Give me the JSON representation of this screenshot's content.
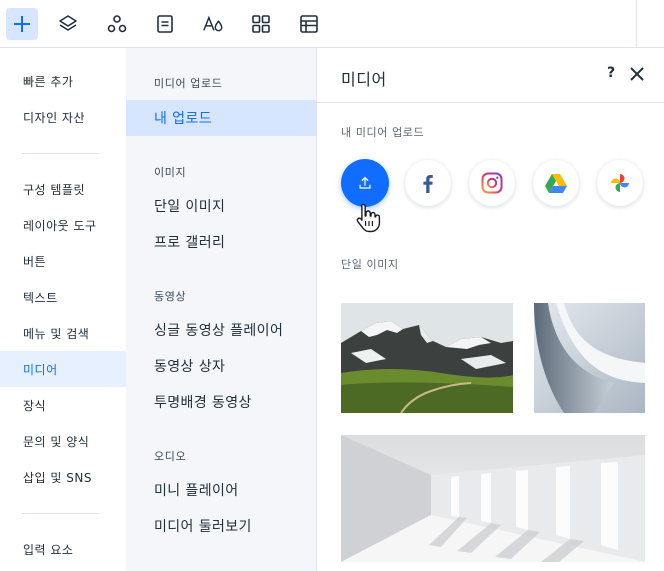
{
  "toolbar": {
    "tools": [
      {
        "icon": "plus-icon",
        "active": true
      },
      {
        "icon": "layers-icon"
      },
      {
        "icon": "apps-icon"
      },
      {
        "icon": "page-icon"
      },
      {
        "icon": "text-theme-icon"
      },
      {
        "icon": "grid-icon"
      },
      {
        "icon": "table-icon"
      }
    ]
  },
  "leftnav": {
    "items": [
      {
        "label": "빠른 추가"
      },
      {
        "label": "디자인 자산"
      },
      {
        "label": "구성 템플릿"
      },
      {
        "label": "레이아웃 도구"
      },
      {
        "label": "버튼"
      },
      {
        "label": "텍스트"
      },
      {
        "label": "메뉴 및 검색"
      },
      {
        "label": "미디어",
        "active": true
      },
      {
        "label": "장식"
      },
      {
        "label": "문의 및 양식"
      },
      {
        "label": "삽입 및 SNS"
      },
      {
        "label": "입력 요소"
      }
    ]
  },
  "midcol": {
    "sections": [
      {
        "heading": "미디어 업로드",
        "items": [
          "내 업로드"
        ]
      },
      {
        "heading": "이미지",
        "items": [
          "단일 이미지",
          "프로 갤러리"
        ]
      },
      {
        "heading": "동영상",
        "items": [
          "싱글 동영상 플레이어",
          "동영상 상자",
          "투명배경 동영상"
        ]
      },
      {
        "heading": "오디오",
        "items": [
          "미니 플레이어",
          "미디어 둘러보기"
        ]
      }
    ]
  },
  "panel": {
    "title": "미디어",
    "help_label": "?",
    "upload_section_label": "내 미디어 업로드",
    "single_image_label": "단일 이미지",
    "sources": [
      {
        "icon": "upload-icon"
      },
      {
        "icon": "facebook-icon"
      },
      {
        "icon": "instagram-icon"
      },
      {
        "icon": "google-drive-icon"
      },
      {
        "icon": "google-photos-icon"
      }
    ]
  },
  "colors": {
    "accent": "#116dff",
    "active_bg": "#d6e6fe",
    "facebook": "#3b5998"
  }
}
